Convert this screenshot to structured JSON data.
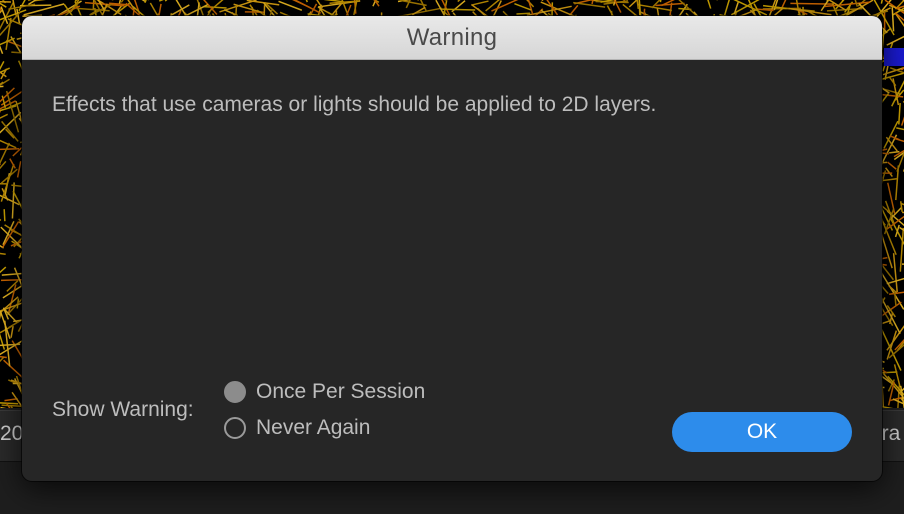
{
  "background": {
    "left_partial_text": "20",
    "right_partial_text": "era"
  },
  "dialog": {
    "title": "Warning",
    "message": "Effects that use cameras or lights should be applied to 2D layers.",
    "show_warning_label": "Show Warning:",
    "options": [
      {
        "label": "Once Per Session",
        "selected": true
      },
      {
        "label": "Never Again",
        "selected": false
      }
    ],
    "ok_label": "OK"
  },
  "colors": {
    "accent": "#2d8ceb",
    "dialog_bg": "#262626",
    "titlebar_bg": "#dcdcdc",
    "text": "#bdbdbd"
  }
}
